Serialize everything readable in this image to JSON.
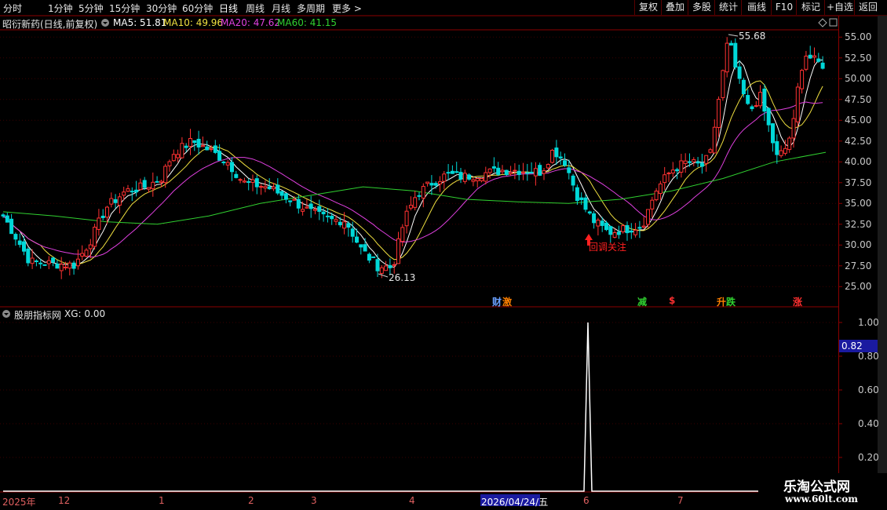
{
  "toolbar": {
    "periods": [
      "分时",
      "1分钟",
      "5分钟",
      "15分钟",
      "30分钟",
      "60分钟",
      "日线",
      "周线",
      "月线",
      "多周期",
      "更多 >"
    ],
    "active_period": "日线",
    "right_buttons": [
      "复权",
      "叠加",
      "多股",
      "统计",
      "画线",
      "F10",
      "标记",
      "+自选",
      "返回"
    ]
  },
  "header": {
    "title": "昭衍新药(日线,前复权)",
    "ma5": "MA5: 51.81",
    "ma10": "MA10: 49.96",
    "ma20": "MA20: 47.62",
    "ma60": "MA60: 41.15"
  },
  "indicator": {
    "name": "股朋指标网",
    "value": "XG: 0.00",
    "cursor_value": "0.82",
    "y_ticks": [
      "1.00",
      "0.80",
      "0.60",
      "0.40",
      "0.20"
    ]
  },
  "price_axis": {
    "y_ticks": [
      "55.00",
      "52.50",
      "50.00",
      "47.50",
      "45.00",
      "42.50",
      "40.00",
      "37.50",
      "35.00",
      "32.50",
      "30.00",
      "27.50",
      "25.00"
    ]
  },
  "time_axis": {
    "labels": [
      "2025年",
      "12",
      "1",
      "2",
      "3",
      "4",
      "2026/04/24/五",
      "6",
      "7"
    ]
  },
  "annotations": {
    "high": "55.68",
    "low": "26.13",
    "note": "回调关注"
  },
  "events": [
    "财",
    "激",
    "减",
    "$",
    "升",
    "跌",
    "涨"
  ],
  "watermark": {
    "line1": "乐淘公式网",
    "line2": "www.60lt.com"
  },
  "colors": {
    "up": "#ff3232",
    "down": "#00d8d8",
    "ma5": "#ffffff",
    "ma10": "#f0e040",
    "ma20": "#e040e0",
    "ma60": "#30d030",
    "frame": "#8b0000"
  },
  "chart_data": {
    "type": "candlestick",
    "y_range": [
      24,
      56.5
    ],
    "ma60_series_approx": [
      34,
      33.5,
      32.8,
      32.5,
      33.5,
      35,
      36,
      37,
      36.5,
      35.5,
      35.2,
      35,
      35.5,
      36.5,
      38,
      40,
      41.15
    ],
    "indicator_signal": {
      "max": 1.0,
      "position": "early June 2026"
    },
    "highest": 55.68,
    "lowest": 26.13
  }
}
